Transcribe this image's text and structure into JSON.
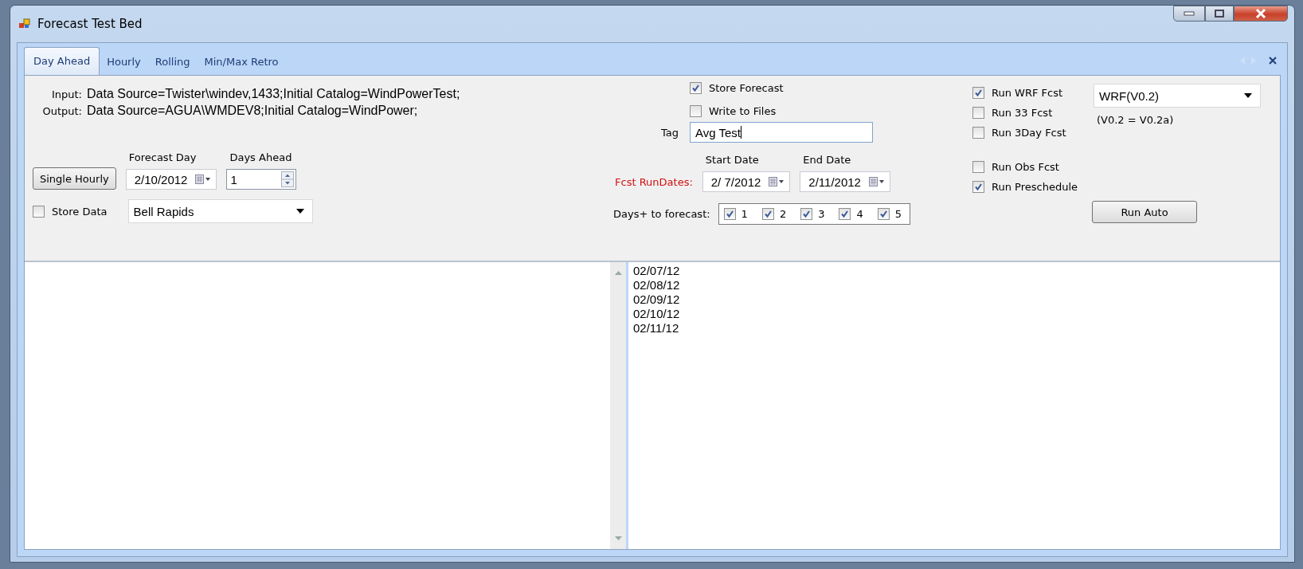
{
  "window": {
    "title": "Forecast Test Bed"
  },
  "tabs": [
    {
      "label": "Day Ahead",
      "selected": true
    },
    {
      "label": "Hourly",
      "selected": false
    },
    {
      "label": "Rolling",
      "selected": false
    },
    {
      "label": "Min/Max Retro",
      "selected": false
    }
  ],
  "connections": [
    {
      "label": "Input:",
      "value": "Data Source=Twister\\windev,1433;Initial Catalog=WindPowerTest;"
    },
    {
      "label": "Output:",
      "value": "Data Source=AGUA\\WMDEV8;Initial Catalog=WindPower;"
    }
  ],
  "single_hourly_button": "Single Hourly",
  "forecast_day": {
    "label": "Forecast Day",
    "value": "2/10/2012"
  },
  "days_ahead": {
    "label": "Days Ahead",
    "value": "1"
  },
  "store_data": {
    "label": "Store Data",
    "checked": false
  },
  "site": {
    "value": "Bell Rapids"
  },
  "store_forecast": {
    "label": "Store Forecast",
    "checked": true
  },
  "write_to_files": {
    "label": "Write to Files",
    "checked": false
  },
  "tag": {
    "label": "Tag",
    "value": "Avg Test"
  },
  "run_dates": {
    "label": "Fcst RunDates:",
    "start_label": "Start Date",
    "start_value": "2/ 7/2012",
    "end_label": "End Date",
    "end_value": "2/11/2012"
  },
  "days_to_forecast": {
    "label": "Days+ to forecast:",
    "days": [
      {
        "label": "1",
        "checked": true
      },
      {
        "label": "2",
        "checked": true
      },
      {
        "label": "3",
        "checked": true
      },
      {
        "label": "4",
        "checked": true
      },
      {
        "label": "5",
        "checked": true
      }
    ]
  },
  "run_options": [
    {
      "label": "Run WRF Fcst",
      "checked": true
    },
    {
      "label": "Run 33 Fcst",
      "checked": false
    },
    {
      "label": "Run 3Day Fcst",
      "checked": false
    },
    {
      "label": "Run Obs Fcst",
      "checked": false
    },
    {
      "label": "Run Preschedule",
      "checked": true
    }
  ],
  "model": {
    "value": "WRF(V0.2)",
    "note": "(V0.2 = V0.2a)"
  },
  "run_auto_button": "Run Auto",
  "output_lines": [
    "02/07/12",
    "02/08/12",
    "02/09/12",
    "02/10/12",
    "02/11/12"
  ]
}
